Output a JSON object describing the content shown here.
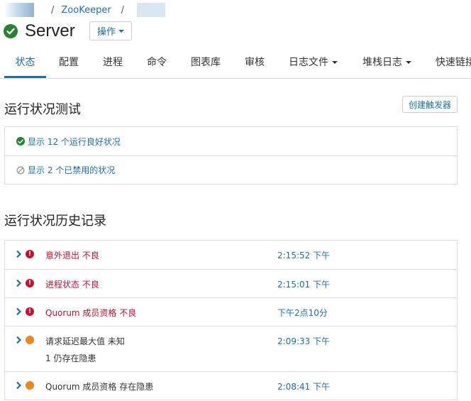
{
  "breadcrumb": {
    "separator": "/",
    "service_link": "ZooKeeper"
  },
  "header": {
    "title": "Server",
    "actions_label": "操作",
    "status": "good"
  },
  "tabs": [
    {
      "label": "状态",
      "active": true
    },
    {
      "label": "配置"
    },
    {
      "label": "进程"
    },
    {
      "label": "命令"
    },
    {
      "label": "图表库"
    },
    {
      "label": "审核"
    },
    {
      "label": "日志文件",
      "dropdown": true
    },
    {
      "label": "堆栈日志",
      "dropdown": true
    },
    {
      "label": "快速链接"
    }
  ],
  "health_tests": {
    "title": "运行状况测试",
    "create_trigger_label": "创建触发器",
    "good_label": "显示 12 个运行良好状况",
    "disabled_label": "显示 2 个已禁用的状况"
  },
  "history": {
    "title": "运行状况历史记录",
    "events": [
      {
        "text": "意外退出 不良",
        "time": "2:15:52 下午",
        "severity": "bad"
      },
      {
        "text": "进程状态 不良",
        "time": "2:15:01 下午",
        "severity": "bad"
      },
      {
        "text": "Quorum 成员资格 不良",
        "time": "下午2点10分",
        "severity": "bad"
      },
      {
        "text": "请求延迟最大值 未知",
        "subtext": "1 仍存在隐患",
        "time": "2:09:33 下午",
        "severity": "warn"
      },
      {
        "text": "Quorum 成员资格 存在隐患",
        "time": "2:08:41 下午",
        "severity": "warn"
      }
    ]
  },
  "colors": {
    "link": "#1e6eae",
    "good": "#26832f",
    "bad": "#c8102e",
    "warn": "#f0851e"
  }
}
